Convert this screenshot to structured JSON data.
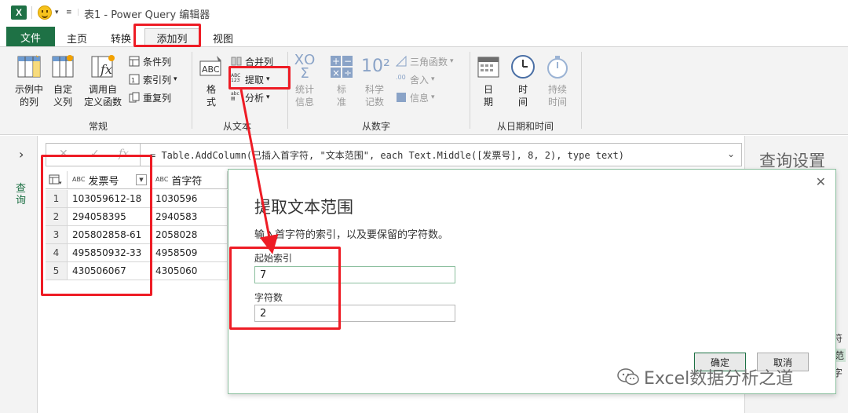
{
  "window": {
    "app_icon": "excel-icon",
    "title": "表1 - Power Query 编辑器"
  },
  "tabs": [
    {
      "label": "文件",
      "active": false
    },
    {
      "label": "主页",
      "active": false
    },
    {
      "label": "转换",
      "active": false
    },
    {
      "label": "添加列",
      "active": true
    },
    {
      "label": "视图",
      "active": false
    }
  ],
  "ribbon": {
    "general": {
      "label": "常规",
      "example_column": "示例中\n的列",
      "custom_column": "自定\n义列",
      "invoke_function": "调用自\n定义函数",
      "conditional_column": "条件列",
      "index_column": "索引列",
      "duplicate_column": "重复列"
    },
    "from_text": {
      "label": "从文本",
      "format": "格\n式",
      "merge_columns": "合并列",
      "extract": "提取",
      "parse": "分析"
    },
    "from_number": {
      "label": "从数字",
      "statistics": "统计\n信息",
      "standard": "标\n准",
      "scientific": "科学\n记数",
      "trigonometry": "三角函数",
      "rounding": "舍入",
      "information": "信息"
    },
    "from_datetime": {
      "label": "从日期和时间",
      "date": "日\n期",
      "time": "时\n间",
      "duration": "持续\n时间"
    }
  },
  "left_pane": {
    "label": "查询"
  },
  "formula_bar": {
    "formula": "= Table.AddColumn(已插入首字符, \"文本范围\", each Text.Middle([发票号], 8, 2), type text)"
  },
  "table": {
    "columns": [
      "发票号",
      "首字符"
    ],
    "type_badge": "ABC",
    "rows": [
      {
        "n": "1",
        "c1": "103059612-18",
        "c2": "1030596"
      },
      {
        "n": "2",
        "c1": "294058395",
        "c2": "2940583"
      },
      {
        "n": "3",
        "c1": "205802858-61",
        "c2": "2058028"
      },
      {
        "n": "4",
        "c1": "495850932-33",
        "c2": "4958509"
      },
      {
        "n": "5",
        "c1": "430506067",
        "c2": "4305060"
      }
    ]
  },
  "right_pane": {
    "title": "查询设置",
    "frag1": "符",
    "frag2": "范",
    "frag3": "字"
  },
  "dialog": {
    "title": "提取文本范围",
    "description": "输入首字符的索引，以及要保留的字符数。",
    "start_index_label": "起始索引",
    "start_index_value": "7",
    "char_count_label": "字符数",
    "char_count_value": "2",
    "ok": "确定",
    "cancel": "取消"
  },
  "watermark": {
    "text": "Excel数据分析之道"
  },
  "colors": {
    "excel_green": "#1e7145",
    "annotation_red": "#ee1c25"
  }
}
